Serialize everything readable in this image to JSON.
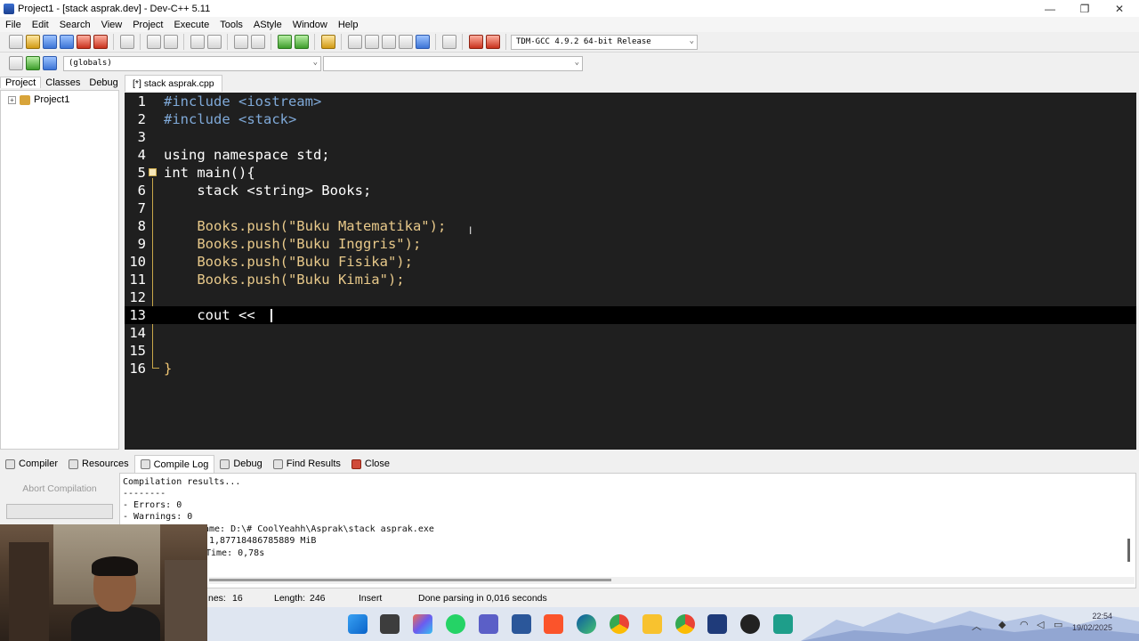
{
  "window": {
    "title": "Project1 - [stack asprak.dev] - Dev-C++ 5.11",
    "controls": {
      "minimize": "—",
      "maximize": "❐",
      "close": "✕"
    }
  },
  "menu": [
    "File",
    "Edit",
    "Search",
    "View",
    "Project",
    "Execute",
    "Tools",
    "AStyle",
    "Window",
    "Help"
  ],
  "toolbar": {
    "compiler_select": "TDM-GCC 4.9.2 64-bit Release",
    "scope_select": "(globals)",
    "symbol_select": ""
  },
  "left_panel": {
    "tabs": [
      "Project",
      "Classes",
      "Debug"
    ],
    "project_tree": [
      {
        "label": "Project1",
        "expander": "+"
      }
    ]
  },
  "editor": {
    "file_tab": "[*] stack asprak.cpp",
    "current_line": 13,
    "lines": [
      {
        "n": "1",
        "text": "#include <iostream>"
      },
      {
        "n": "2",
        "text": "#include <stack>"
      },
      {
        "n": "3",
        "text": ""
      },
      {
        "n": "4",
        "text": "using namespace std;"
      },
      {
        "n": "5",
        "text": "int main(){"
      },
      {
        "n": "6",
        "text": "    stack <string> Books;"
      },
      {
        "n": "7",
        "text": ""
      },
      {
        "n": "8",
        "text": "    Books.push(\"Buku Matematika\");"
      },
      {
        "n": "9",
        "text": "    Books.push(\"Buku Inggris\");"
      },
      {
        "n": "10",
        "text": "    Books.push(\"Buku Fisika\");"
      },
      {
        "n": "11",
        "text": "    Books.push(\"Buku Kimia\");"
      },
      {
        "n": "12",
        "text": ""
      },
      {
        "n": "13",
        "text": "    cout << "
      },
      {
        "n": "14",
        "text": ""
      },
      {
        "n": "15",
        "text": ""
      },
      {
        "n": "16",
        "text": "}"
      }
    ]
  },
  "bottom_panel": {
    "tabs": [
      "Compiler",
      "Resources",
      "Compile Log",
      "Debug",
      "Find Results",
      "Close"
    ],
    "active_tab": "Compile Log",
    "abort_button": "Abort Compilation",
    "log_lines": [
      "Compilation results...",
      "--------",
      "- Errors: 0",
      "- Warnings: 0",
      "",
      "ame: D:\\# CoolYeahh\\Asprak\\stack asprak.exe",
      " 1,87718486785889 MiB",
      "Time: 0,78s"
    ]
  },
  "statusbar": {
    "lines_label": "nes:",
    "lines_value": "16",
    "length_label": "Length:",
    "length_value": "246",
    "mode": "Insert",
    "message": "Done parsing in 0,016 seconds"
  },
  "taskbar": {
    "clock_time": "22:54",
    "clock_date": "19/02/2025"
  },
  "colors": {
    "editor_bg": "#1f1f1f",
    "current_line_bg": "#000000",
    "string": "#e8c98a",
    "preprocessor": "#7fa9d8"
  }
}
